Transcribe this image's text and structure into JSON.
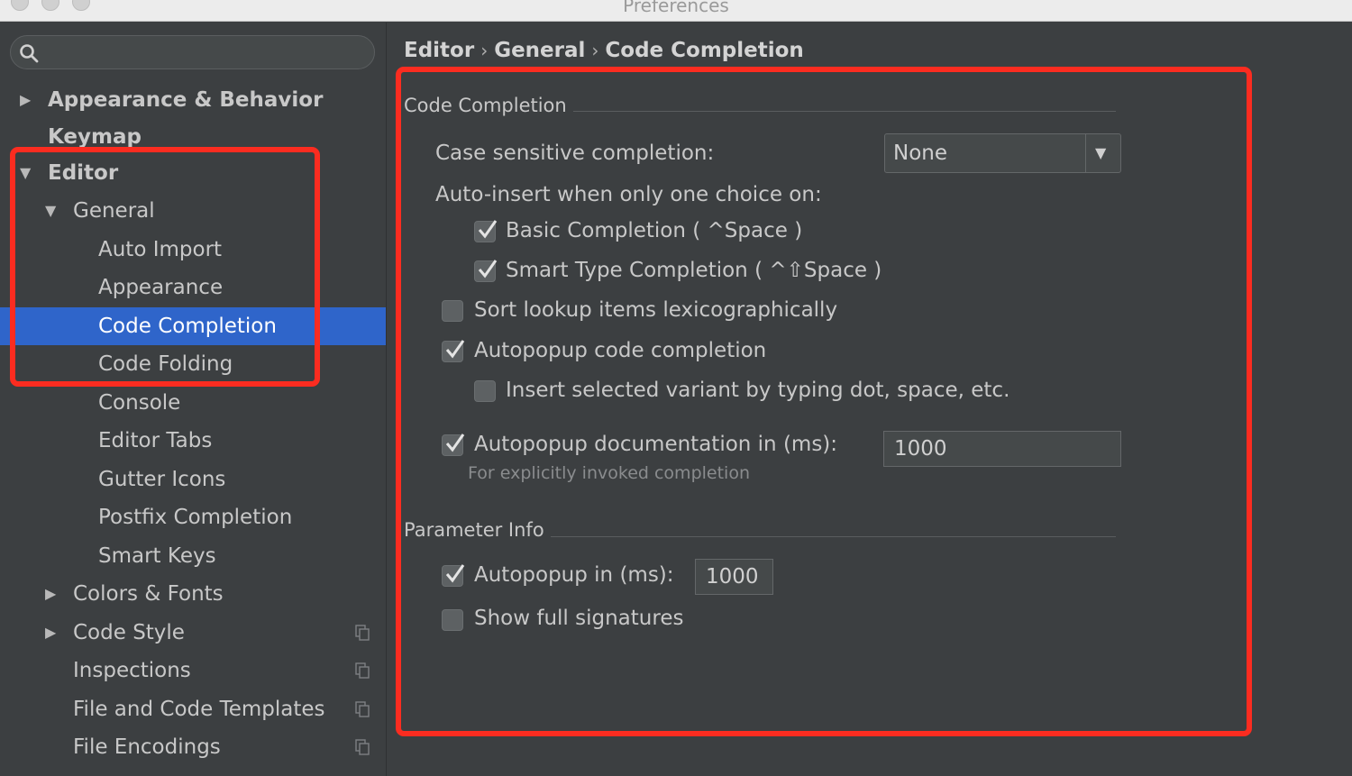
{
  "window": {
    "title": "Preferences"
  },
  "sidebar": {
    "search": {
      "placeholder": ""
    },
    "items": [
      {
        "label": "Appearance & Behavior",
        "arrow": "▶"
      },
      {
        "label": "Keymap"
      },
      {
        "label": "Editor",
        "arrow": "▼"
      },
      {
        "label": "General",
        "arrow": "▼"
      },
      {
        "label": "Auto Import"
      },
      {
        "label": "Appearance"
      },
      {
        "label": "Code Completion"
      },
      {
        "label": "Code Folding"
      },
      {
        "label": "Console"
      },
      {
        "label": "Editor Tabs"
      },
      {
        "label": "Gutter Icons"
      },
      {
        "label": "Postfix Completion"
      },
      {
        "label": "Smart Keys"
      },
      {
        "label": "Colors & Fonts",
        "arrow": "▶"
      },
      {
        "label": "Code Style",
        "arrow": "▶"
      },
      {
        "label": "Inspections"
      },
      {
        "label": "File and Code Templates"
      },
      {
        "label": "File Encodings"
      }
    ]
  },
  "breadcrumb": {
    "items": [
      "Editor",
      "General",
      "Code Completion"
    ],
    "separator": "›"
  },
  "code_completion": {
    "section_title": "Code Completion",
    "case_sensitive_label": "Case sensitive completion:",
    "case_sensitive_value": "None",
    "auto_insert_label": "Auto-insert when only one choice on:",
    "basic_completion": {
      "label": "Basic Completion ( ^Space )",
      "checked": true
    },
    "smart_type_completion": {
      "label": "Smart Type Completion ( ^⇧Space )",
      "checked": true
    },
    "sort_lookup": {
      "label": "Sort lookup items lexicographically",
      "checked": false
    },
    "autopopup_code": {
      "label": "Autopopup code completion",
      "checked": true
    },
    "insert_selected": {
      "label": "Insert selected variant by typing dot, space, etc.",
      "checked": false
    },
    "autopopup_doc": {
      "label": "Autopopup documentation in (ms):",
      "checked": true,
      "value": "1000"
    },
    "autopopup_doc_hint": "For explicitly invoked completion"
  },
  "parameter_info": {
    "section_title": "Parameter Info",
    "autopopup": {
      "label": "Autopopup in (ms):",
      "checked": true,
      "value": "1000"
    },
    "show_full_signatures": {
      "label": "Show full signatures",
      "checked": false
    }
  },
  "colors": {
    "selection": "#2f65ca",
    "annotation": "#fb2c20",
    "background": "#3c3f41"
  }
}
